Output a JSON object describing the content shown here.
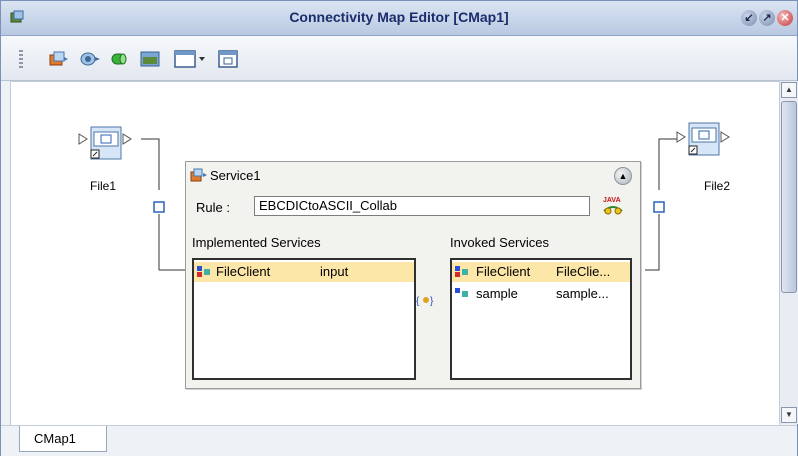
{
  "window": {
    "title": "Connectivity Map Editor [CMap1]"
  },
  "toolbar": {
    "items": [
      "service-add-icon",
      "external-app-icon",
      "web-connector-icon",
      "image-icon",
      "view-menu-icon",
      "window-icon"
    ]
  },
  "nodes": {
    "file1_label": "File1",
    "file2_label": "File2"
  },
  "service": {
    "title": "Service1",
    "rule_label": "Rule :",
    "rule_value": "EBCDICtoASCII_Collab",
    "java_badge": "JAVA",
    "implemented_label": "Implemented Services",
    "invoked_label": "Invoked Services",
    "implemented": [
      {
        "name": "FileClient",
        "value": "input",
        "selected": true
      }
    ],
    "invoked": [
      {
        "name": "FileClient",
        "value": "FileClie...",
        "selected": true
      },
      {
        "name": "sample",
        "value": "sample...",
        "selected": false
      }
    ]
  },
  "tabs": {
    "cmap1": "CMap1"
  },
  "colors": {
    "selection": "#fce6a8",
    "connector": "#2a63b8"
  }
}
